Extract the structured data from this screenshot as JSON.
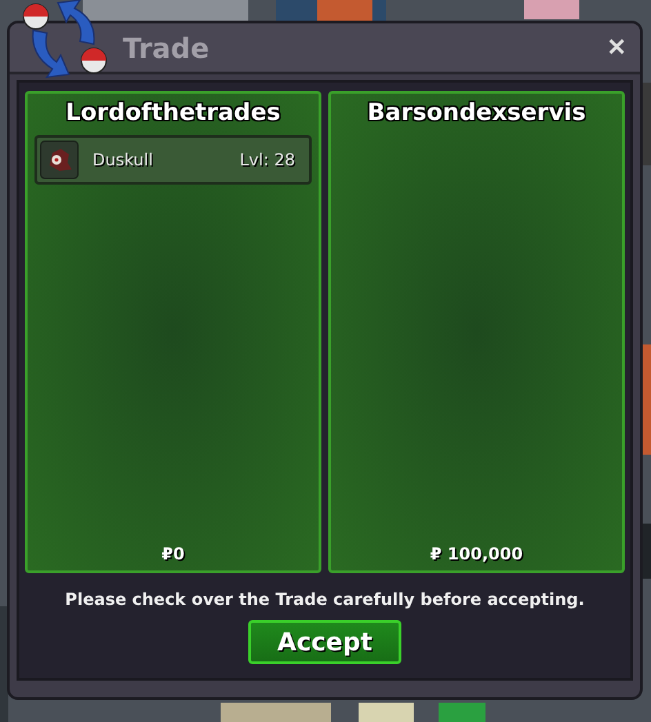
{
  "window": {
    "title": "Trade",
    "close": "✕"
  },
  "sides": [
    {
      "trader": "Lordofthetrades",
      "items": [
        {
          "name": "Duskull",
          "level": "Lvl: 28"
        }
      ],
      "money": "₽0"
    },
    {
      "trader": "Barsondexservis",
      "money": "₽ 100,000"
    }
  ],
  "message": "Please check over the Trade carefully before accepting.",
  "accept_button": "Accept"
}
